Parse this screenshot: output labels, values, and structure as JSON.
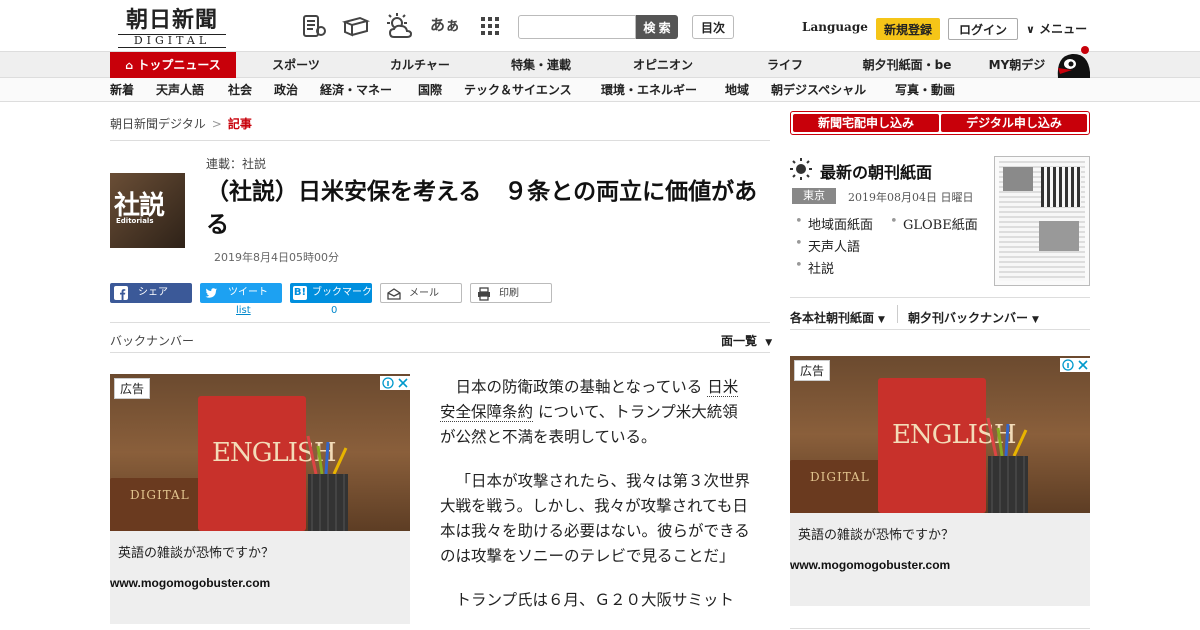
{
  "header": {
    "logo_jp": "朝日新聞",
    "logo_en": "DIGITAL",
    "font_size_icon": "あぁ",
    "search_placeholder": "",
    "search_label": "検 索",
    "toc_label": "目次",
    "language": "Language",
    "signup": "新規登録",
    "login": "ログイン",
    "menu": "メニュー"
  },
  "nav": {
    "main": [
      "トップニュース",
      "スポーツ",
      "カルチャー",
      "特集・連載",
      "オピニオン",
      "ライフ",
      "朝夕刊紙面・be",
      "MY朝デジ"
    ],
    "sub": [
      "新着",
      "天声人語",
      "社会",
      "政治",
      "経済・マネー",
      "国際",
      "テック＆サイエンス",
      "環境・エネルギー",
      "地域",
      "朝デジスペシャル",
      "写真・動画"
    ]
  },
  "breadcrumb": {
    "home": "朝日新聞デジタル",
    "sep": ">",
    "current": "記事"
  },
  "article": {
    "badge_kanji": "社説",
    "badge_en": "Editorials",
    "series": "連載：社説",
    "title": "（社説）日米安保を考える　９条との両立に価値がある",
    "date": "2019年8月4日05時00分",
    "share": {
      "facebook": "シェア",
      "twitter": "ツイート",
      "hatena_icon": "B!",
      "hatena": "ブックマーク",
      "mail": "メール",
      "print": "印刷",
      "twitter_count": "list",
      "hatena_count": "0"
    },
    "back_number": "バックナンバー",
    "list_label": "面一覧",
    "p1_before": "日本の防衛政策の基軸となっている",
    "p1_link": "日米安全保障条約",
    "p1_after": "について、トランプ米大統領が公然と不満を表明している。",
    "p2": "「日本が攻撃されたら、我々は第３次世界大戦を戦う。しかし、我々が攻撃されても日本は我々を助ける必要はない。彼らができるのは攻撃をソニーのテレビで見ることだ」",
    "p3": "トランプ氏は６月、Ｇ２０大阪サミット"
  },
  "ad": {
    "label": "広告",
    "book_title": "ENGLISH",
    "old_book_title": "DIGITAL",
    "copy": "英語の雑談が恐怖ですか？",
    "url": "www.mogomogobuster.com"
  },
  "right": {
    "subscribe_paper": "新聞宅配申し込み",
    "subscribe_digital": "デジタル申し込み",
    "latest_title": "最新の朝刊紙面",
    "region": "東京",
    "paper_date": "2019年08月04日 日曜日",
    "links": [
      "地域面紙面",
      "GLOBE紙面",
      "天声人語",
      "社説"
    ],
    "dropdown1": "各本社朝刊紙面",
    "dropdown2": "朝夕刊バックナンバー"
  },
  "colors": {
    "brand_red": "#c8000a",
    "signup_yellow": "#f5c518",
    "facebook": "#3b5998",
    "twitter": "#1da1f2",
    "hatena": "#008fde"
  }
}
